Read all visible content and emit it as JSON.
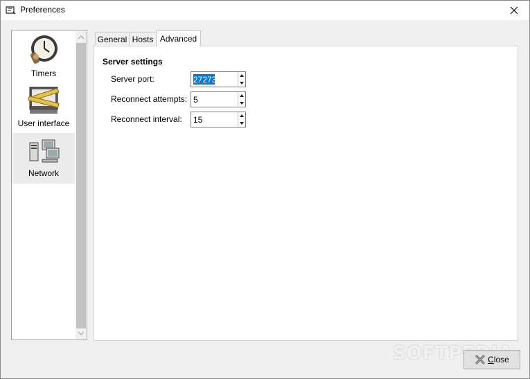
{
  "window": {
    "title": "Preferences"
  },
  "sidebar": {
    "items": [
      {
        "label": "Timers",
        "icon": "stopwatch-icon",
        "selected": false
      },
      {
        "label": "User interface",
        "icon": "monitor-ruler-icon",
        "selected": false
      },
      {
        "label": "Network",
        "icon": "network-computers-icon",
        "selected": true
      }
    ]
  },
  "tabs": [
    {
      "label": "General",
      "active": false
    },
    {
      "label": "Hosts",
      "active": false
    },
    {
      "label": "Advanced",
      "active": true
    }
  ],
  "panel": {
    "section_title": "Server settings",
    "fields": [
      {
        "label": "Server port:",
        "value": "27273",
        "selected": true
      },
      {
        "label": "Reconnect attempts:",
        "value": "5",
        "selected": false
      },
      {
        "label": "Reconnect interval:",
        "value": "15",
        "selected": false
      }
    ]
  },
  "footer": {
    "close_label_underlined": "C",
    "close_label_rest": "lose"
  },
  "watermark": {
    "text": "SOFTPEDIA"
  },
  "colors": {
    "selection": "#0078d7",
    "sidebar_selected": "#ececec",
    "scroll_thumb": "#c2c2c2"
  }
}
